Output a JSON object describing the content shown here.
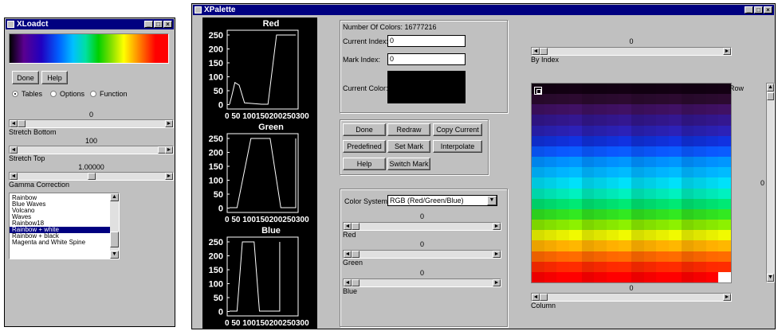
{
  "xloadct": {
    "title": "XLoadct",
    "done": "Done",
    "help": "Help",
    "radios": [
      {
        "label": "Tables",
        "selected": true
      },
      {
        "label": "Options",
        "selected": false
      },
      {
        "label": "Function",
        "selected": false
      }
    ],
    "stretch_bottom": {
      "value": "0",
      "label": "Stretch Bottom"
    },
    "stretch_top": {
      "value": "100",
      "label": "Stretch Top"
    },
    "gamma": {
      "value": "1.00000",
      "label": "Gamma Correction"
    },
    "tables": [
      "Rainbow",
      "Blue Waves",
      "Volcano",
      "Waves",
      "Rainbow18",
      "Rainbow + white",
      "Rainbow + black",
      "Magenta and White Spine"
    ],
    "selected_table": "Rainbow + white"
  },
  "xpalette": {
    "title": "XPalette",
    "plots": [
      {
        "title": "Red",
        "values": [
          0,
          80,
          0,
          0,
          255,
          255
        ]
      },
      {
        "title": "Green",
        "values": [
          0,
          0,
          255,
          255,
          0,
          255
        ]
      },
      {
        "title": "Blue",
        "values": [
          0,
          255,
          255,
          0,
          0,
          255
        ]
      }
    ],
    "y_ticks": [
      "250",
      "200",
      "150",
      "100",
      "50",
      "0"
    ],
    "x_ticks_text": "0  50 100150200250300",
    "info": {
      "num_colors": "Number Of Colors: 16777216",
      "current_index_label": "Current Index:",
      "current_index": "0",
      "mark_index_label": "Mark Index:",
      "mark_index": "0",
      "current_color_label": "Current Color:"
    },
    "buttons": [
      "Done",
      "Redraw",
      "Copy Current",
      "Predefined",
      "Set Mark",
      "Interpolate",
      "Help",
      "Switch Mark"
    ],
    "color_system_label": "Color System:",
    "color_system": "RGB  (Red/Green/Blue)",
    "channels": [
      {
        "value": "0",
        "label": "Red"
      },
      {
        "value": "0",
        "label": "Green"
      },
      {
        "value": "0",
        "label": "Blue"
      }
    ],
    "by_index": {
      "value": "0",
      "label": "By Index"
    },
    "row": {
      "label": "Row",
      "value": "0"
    },
    "column": {
      "value": "0",
      "label": "Column"
    }
  }
}
